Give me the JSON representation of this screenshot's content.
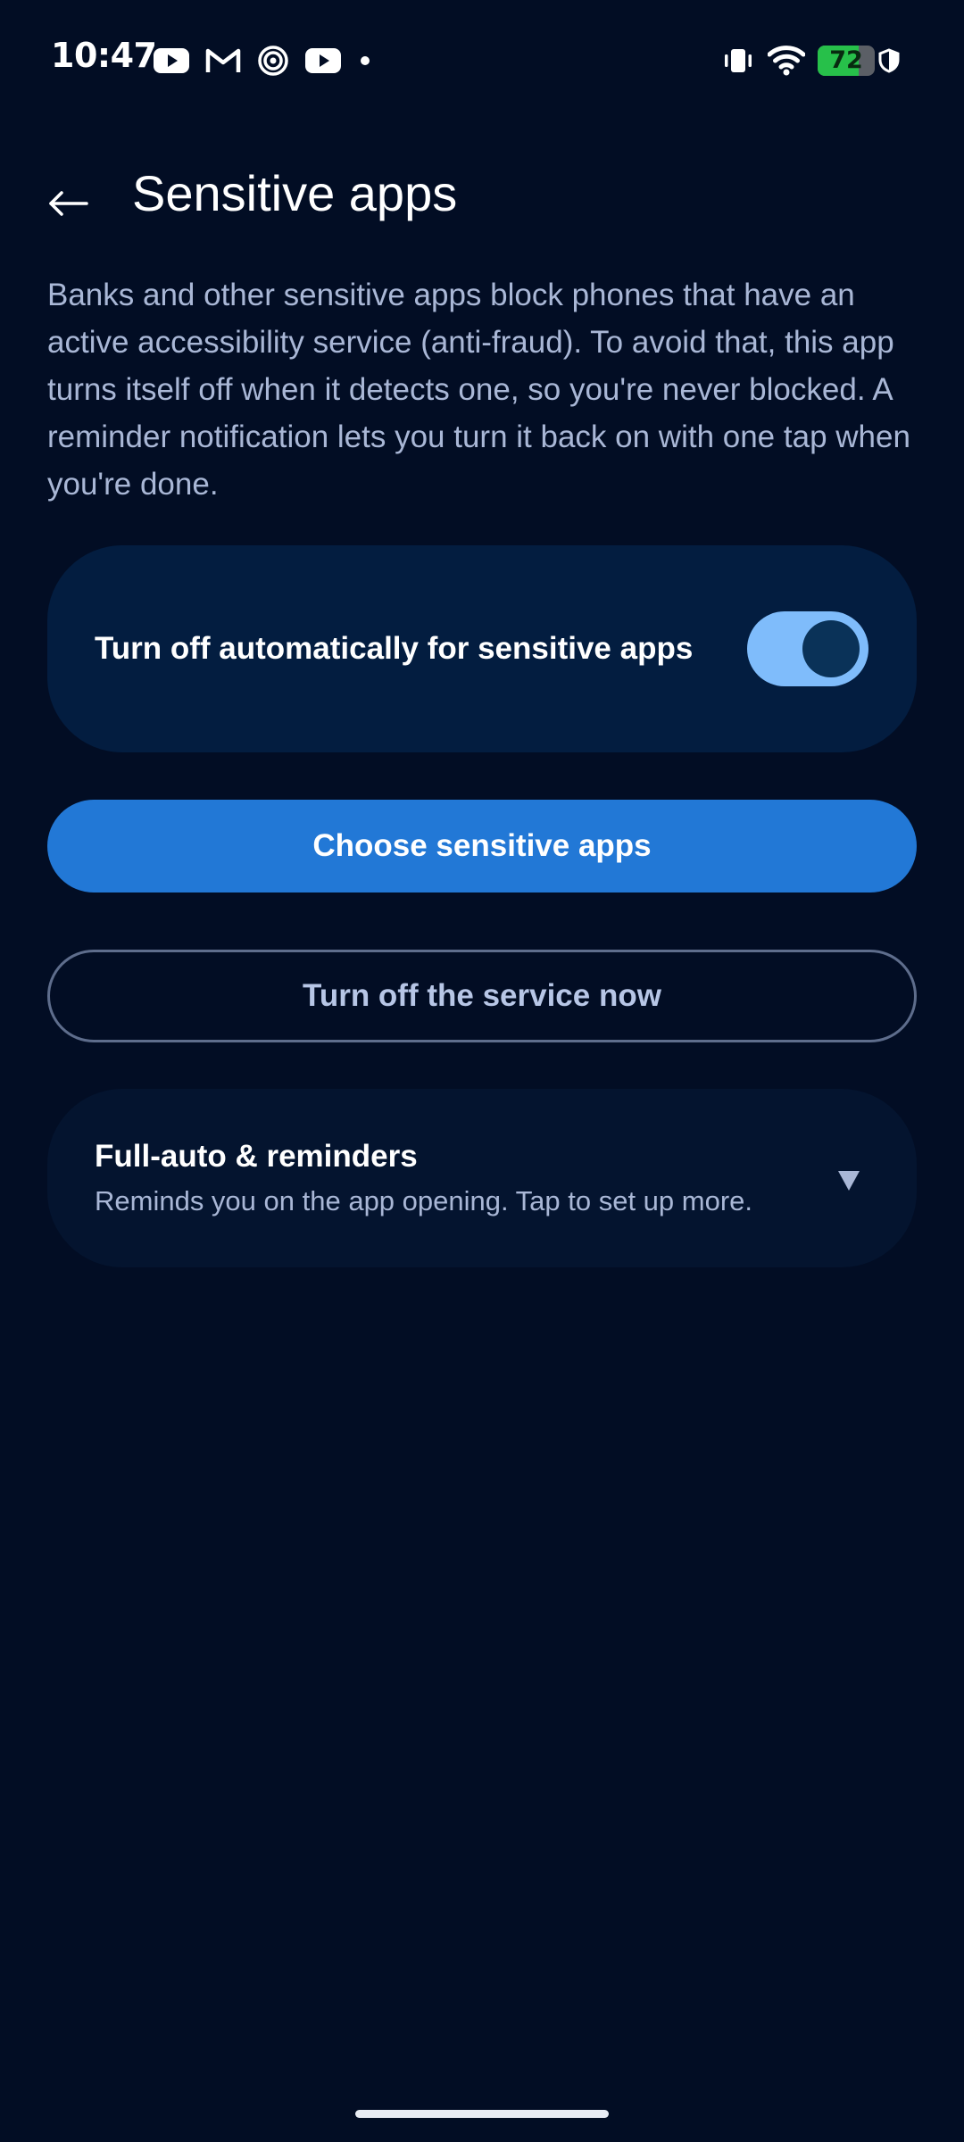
{
  "status_bar": {
    "time": "10:47",
    "left_icons": [
      "youtube-icon",
      "gmail-icon",
      "spiral-app-icon",
      "youtube-icon",
      "more-notifications-dot"
    ],
    "right_icons": [
      "vibrate-icon",
      "wifi-icon",
      "battery-icon",
      "shield-icon"
    ],
    "battery_level": "72",
    "battery_fraction": 0.72
  },
  "header": {
    "back_icon": "arrow-left-icon",
    "title": "Sensitive apps"
  },
  "description": "Banks and other sensitive apps block phones that have an active accessibility service (anti-fraud). To avoid that, this app turns itself off when it detects one, so you're never blocked. A reminder notification lets you turn it back on with one tap when you're done.",
  "toggle_card": {
    "label": "Turn off automatically for sensitive apps",
    "enabled": true
  },
  "buttons": {
    "choose": "Choose sensitive apps",
    "turn_off_now": "Turn off the service now"
  },
  "expand_card": {
    "title": "Full-auto & reminders",
    "subtitle": "Reminds you on the app opening. Tap to set up more.",
    "icon": "triangle-down-icon"
  },
  "colors": {
    "background": "#020d24",
    "card": "#031d40",
    "primary": "#2278d6",
    "switch_track": "#7fbcfb",
    "battery_green": "#27c04a"
  }
}
